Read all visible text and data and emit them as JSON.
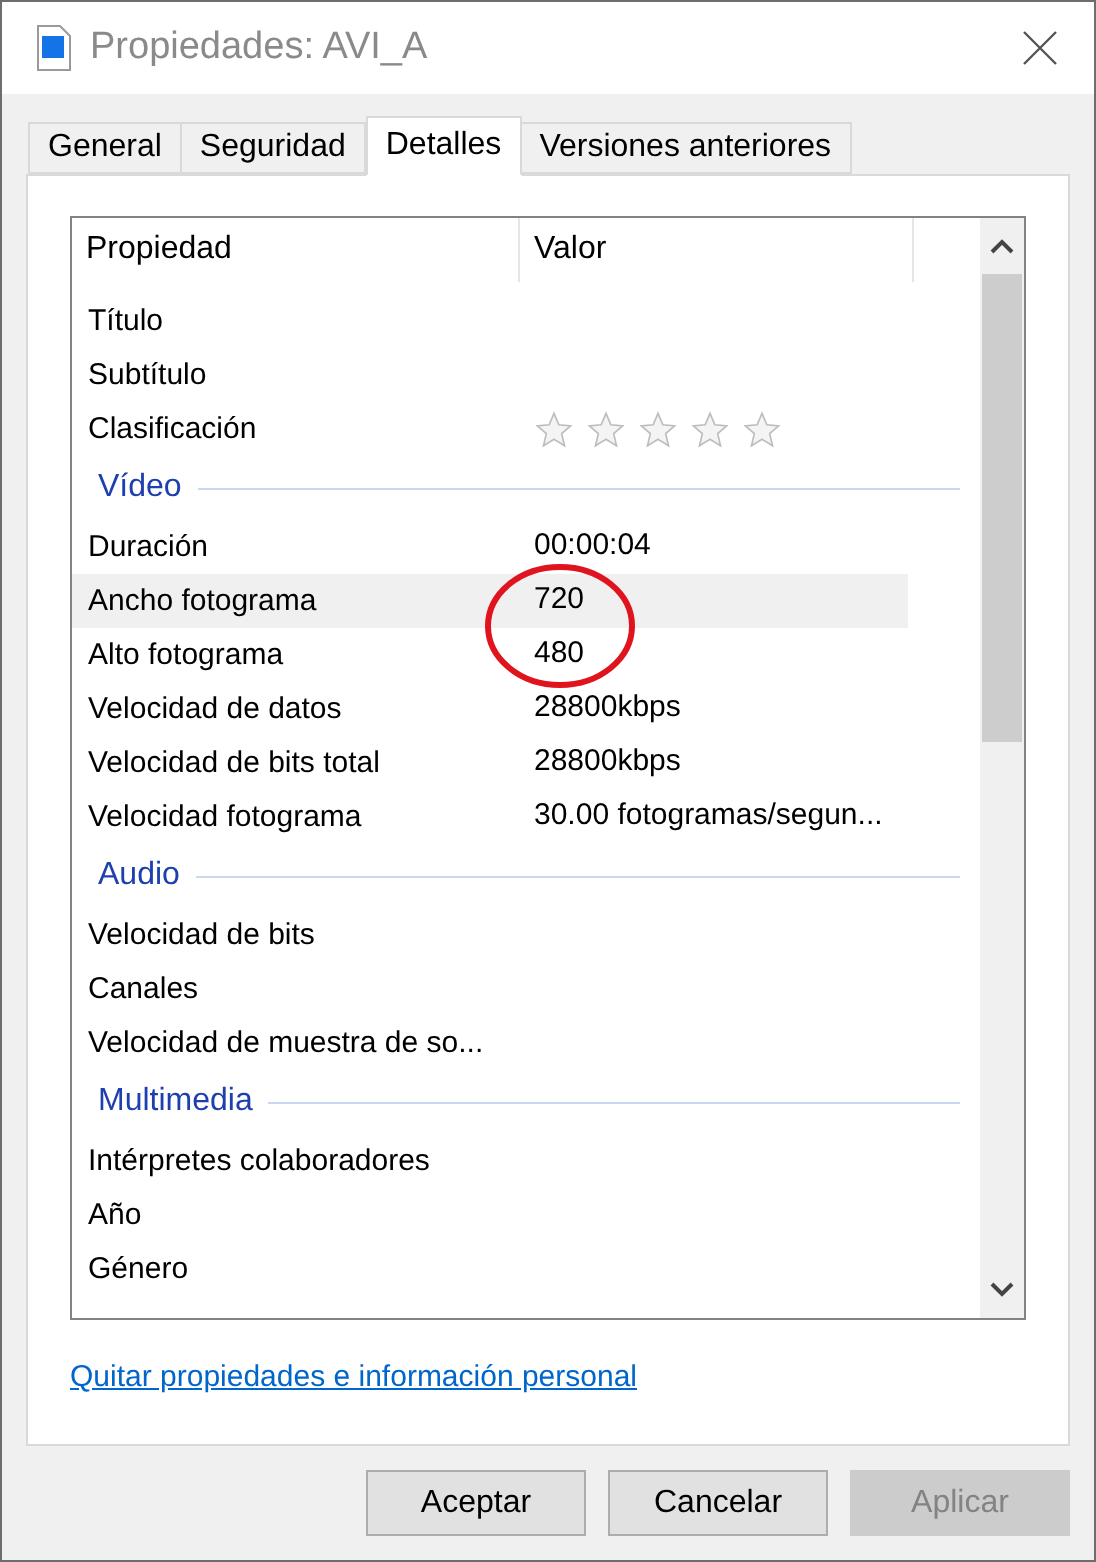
{
  "window": {
    "title": "Propiedades: AVI_A"
  },
  "tabs": [
    {
      "label": "General",
      "selected": false
    },
    {
      "label": "Seguridad",
      "selected": false
    },
    {
      "label": "Detalles",
      "selected": true
    },
    {
      "label": "Versiones anteriores",
      "selected": false
    }
  ],
  "table": {
    "columns": [
      "Propiedad",
      "Valor"
    ],
    "rows": [
      {
        "kind": "property",
        "name": "Título",
        "highlighted": false
      },
      {
        "kind": "property",
        "name": "Subtítulo",
        "highlighted": false
      },
      {
        "kind": "rating",
        "name": "Clasificación",
        "stars": 0,
        "highlighted": false
      },
      {
        "kind": "section",
        "label": "Vídeo"
      },
      {
        "kind": "property",
        "name": "Duración",
        "value": "00:00:04",
        "highlighted": false
      },
      {
        "kind": "property",
        "name": "Ancho fotograma",
        "value": "720",
        "highlighted": true
      },
      {
        "kind": "property",
        "name": "Alto fotograma",
        "value": "480",
        "highlighted": false
      },
      {
        "kind": "property",
        "name": "Velocidad de datos",
        "value": "28800kbps",
        "highlighted": false
      },
      {
        "kind": "property",
        "name": "Velocidad de bits total",
        "value": "28800kbps",
        "highlighted": false
      },
      {
        "kind": "property",
        "name": "Velocidad fotograma",
        "value": "30.00 fotogramas/segun...",
        "highlighted": false
      },
      {
        "kind": "section",
        "label": "Audio"
      },
      {
        "kind": "property",
        "name": "Velocidad de bits",
        "highlighted": false
      },
      {
        "kind": "property",
        "name": "Canales",
        "highlighted": false
      },
      {
        "kind": "property",
        "name": "Velocidad de muestra de so...",
        "highlighted": false
      },
      {
        "kind": "section",
        "label": "Multimedia"
      },
      {
        "kind": "property",
        "name": "Intérpretes colaboradores",
        "highlighted": false
      },
      {
        "kind": "property",
        "name": "Año",
        "highlighted": false
      },
      {
        "kind": "property",
        "name": "Género",
        "highlighted": false
      }
    ]
  },
  "link": "Quitar propiedades e información personal",
  "buttons": [
    {
      "label": "Aceptar",
      "disabled": false
    },
    {
      "label": "Cancelar",
      "disabled": false
    },
    {
      "label": "Aplicar",
      "disabled": true
    }
  ]
}
